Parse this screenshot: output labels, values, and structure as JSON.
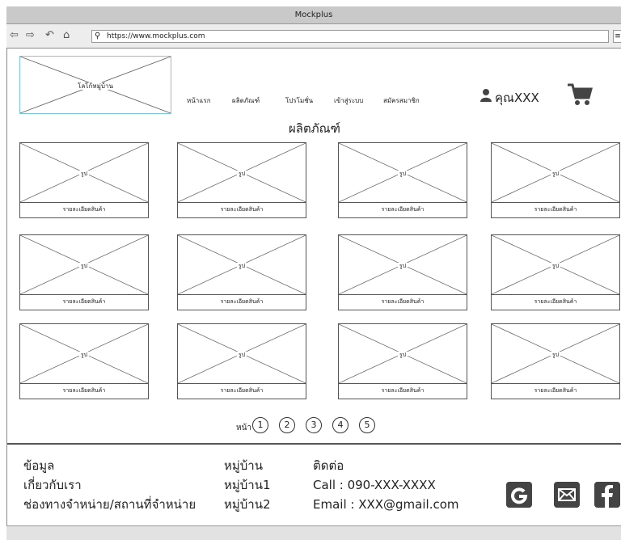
{
  "window": {
    "title": "Mockplus"
  },
  "browser": {
    "url": "https://www.mockplus.com"
  },
  "header": {
    "logo_text": "โลโก้หมู่บ้าน",
    "nav": [
      "หน้าแรก",
      "ผลิตภัณฑ์",
      "โปรโมชั่น",
      "เข้าสู่ระบบ",
      "สมัครสมาชิก"
    ],
    "user_name": "คุณXXX"
  },
  "products": {
    "title": "ผลิตภัณฑ์",
    "image_label": "รูป",
    "items": [
      "รายละเอียดสินค้า",
      "รายละเอียดสินค้า",
      "รายละเอียดสินค้า",
      "รายละเอียดสินค้า",
      "รายละเอียดสินค้า",
      "รายละเอียดสินค้า",
      "รายละเอียดสินค้า",
      "รายละเอียดสินค้า",
      "รายละเอียดสินค้า",
      "รายละเอียดสินค้า",
      "รายละเอียดสินค้า",
      "รายละเอียดสินค้า"
    ]
  },
  "pagination": {
    "label": "หน้า",
    "pages": [
      "1",
      "2",
      "3",
      "4",
      "5"
    ]
  },
  "footer": {
    "info": [
      "ข้อมูล",
      "เกี่ยวกับเรา",
      "ช่องทางจำหน่าย/สถานที่จำหน่าย"
    ],
    "village": [
      "หมู่บ้าน",
      "หมู่บ้าน1",
      "หมู่บ้าน2"
    ],
    "contact": [
      "ติดต่อ",
      "Call : 090-XXX-XXXX",
      "Email : XXX@gmail.com"
    ],
    "social_icons": [
      "google-icon",
      "mail-icon",
      "facebook-icon"
    ]
  }
}
